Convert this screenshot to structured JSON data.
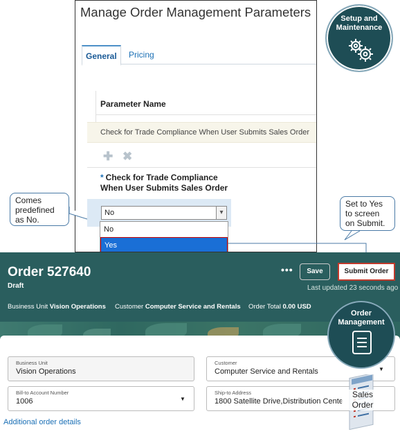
{
  "params": {
    "title": "Manage Order Management Parameters",
    "tabs": [
      "General",
      "Pricing"
    ],
    "column_header": "Parameter Name",
    "row_text": "Check for Trade Compliance When User Submits Sales Order",
    "required_mark": "*",
    "field_label_line1": "Check for Trade Compliance",
    "field_label_line2": "When User Submits Sales Order",
    "selected_value": "No",
    "options": [
      "No",
      "Yes"
    ]
  },
  "setup": {
    "label_line1": "Setup and",
    "label_line2": "Maintenance",
    "icon": "gears-icon"
  },
  "callouts": {
    "left": [
      "Comes",
      "predefined",
      "as No."
    ],
    "right": [
      "Set to Yes",
      "to screen",
      "on Submit."
    ]
  },
  "order": {
    "title": "Order 527640",
    "status": "Draft",
    "more": "•••",
    "save_label": "Save",
    "submit_label": "Submit Order",
    "last_updated": "Last updated 23 seconds ago",
    "summary": {
      "bu_label": "Business Unit",
      "bu_value": "Vision Operations",
      "cust_label": "Customer",
      "cust_value": "Computer Service and Rentals",
      "total_label": "Order Total",
      "total_value": "0.00 USD"
    },
    "fields": {
      "bu_caption": "Business Unit",
      "bu_value": "Vision Operations",
      "cust_caption": "Customer",
      "cust_value": "Computer Service and Rentals",
      "bill_caption": "Bill-to Account Number",
      "bill_value": "1006",
      "ship_caption": "Ship-to Address",
      "ship_value": "1800 Satellite Drive,Distribution Cente"
    },
    "additional_link": "Additional order details"
  },
  "om": {
    "label_line1": "Order",
    "label_line2": "Management",
    "icon": "document-icon"
  },
  "sales": {
    "line1": "Sales",
    "line2": "Order"
  },
  "colors": {
    "header_bg": "#2a5e5e",
    "circle_bg": "#1e4d55",
    "selected_option": "#1a6fd6",
    "highlight_border": "#c0392b",
    "link": "#1a6fb5"
  }
}
